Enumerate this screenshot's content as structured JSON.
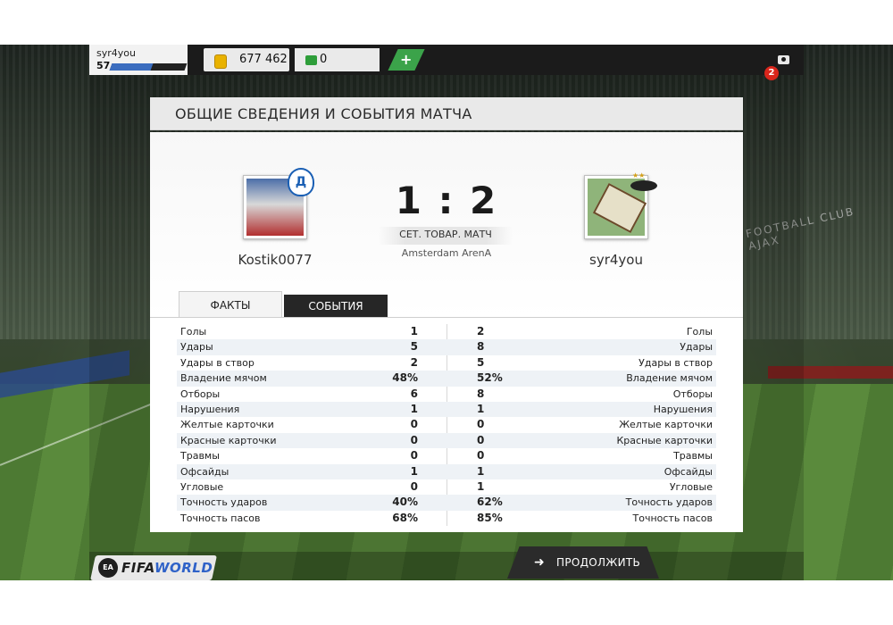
{
  "topbar": {
    "username": "syr4you",
    "level": "57",
    "xp_progress": 0.55,
    "coins": "677 462",
    "cash": "0",
    "add_button": "+",
    "notifications_count": "2"
  },
  "panel": {
    "title": "ОБЩИЕ СВЕДЕНИЯ И СОБЫТИЯ МАТЧА"
  },
  "match": {
    "home_name": "Kostik0077",
    "away_name": "syr4you",
    "score": "1 : 2",
    "match_type": "СЕТ. ТОВАР. МАТЧ",
    "stadium": "Amsterdam ArenA",
    "home_badge": "Д"
  },
  "tabs": {
    "facts": "ФАКТЫ",
    "events": "СОБЫТИЯ"
  },
  "stats": [
    {
      "label": "Голы",
      "home": "1",
      "away": "2"
    },
    {
      "label": "Удары",
      "home": "5",
      "away": "8"
    },
    {
      "label": "Удары в створ",
      "home": "2",
      "away": "5"
    },
    {
      "label": "Владение мячом",
      "home": "48%",
      "away": "52%"
    },
    {
      "label": "Отборы",
      "home": "6",
      "away": "8"
    },
    {
      "label": "Нарушения",
      "home": "1",
      "away": "1"
    },
    {
      "label": "Желтые карточки",
      "home": "0",
      "away": "0"
    },
    {
      "label": "Красные карточки",
      "home": "0",
      "away": "0"
    },
    {
      "label": "Травмы",
      "home": "0",
      "away": "0"
    },
    {
      "label": "Офсайды",
      "home": "1",
      "away": "1"
    },
    {
      "label": "Угловые",
      "home": "0",
      "away": "1"
    },
    {
      "label": "Точность ударов",
      "home": "40%",
      "away": "62%"
    },
    {
      "label": "Точность пасов",
      "home": "68%",
      "away": "85%"
    }
  ],
  "bottom": {
    "logo_ea": "EA",
    "logo_fifa": "FIFA",
    "logo_world": "WORLD",
    "continue_arrow": "➜",
    "continue_label": "ПРОДОЛЖИТЬ"
  },
  "background": {
    "stadium_banner": "FOOTBALL CLUB AJAX"
  }
}
